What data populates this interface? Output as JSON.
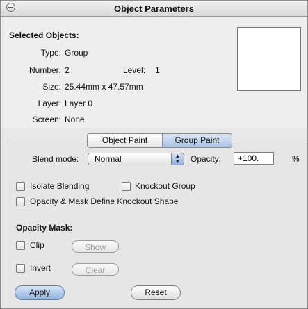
{
  "window": {
    "title": "Object Parameters"
  },
  "info": {
    "heading": "Selected Objects:",
    "type_label": "Type:",
    "type_value": "Group",
    "number_label": "Number:",
    "number_value": "2",
    "level_label": "Level:",
    "level_value": "1",
    "size_label": "Size:",
    "size_value": "25.44mm x 47.57mm",
    "layer_label": "Layer:",
    "layer_value": "Layer 0",
    "screen_label": "Screen:",
    "screen_value": "None"
  },
  "tabs": [
    {
      "label": "Object Paint",
      "selected": false
    },
    {
      "label": "Group Paint",
      "selected": true
    }
  ],
  "blend": {
    "label": "Blend mode:",
    "value": "Normal",
    "opacity_label": "Opacity:",
    "opacity_value": "+100.",
    "unit": "%"
  },
  "options": {
    "isolate": "Isolate Blending",
    "knockout": "Knockout Group",
    "opacity_mask_define": "Opacity & Mask Define Knockout Shape"
  },
  "opacity_mask": {
    "heading": "Opacity Mask:",
    "clip": "Clip",
    "show": "Show",
    "invert": "Invert",
    "clear": "Clear"
  },
  "buttons": {
    "apply": "Apply",
    "reset": "Reset"
  },
  "colors": {
    "default_button": "#8fb3de",
    "selected_tab": "#a9c3e3"
  }
}
